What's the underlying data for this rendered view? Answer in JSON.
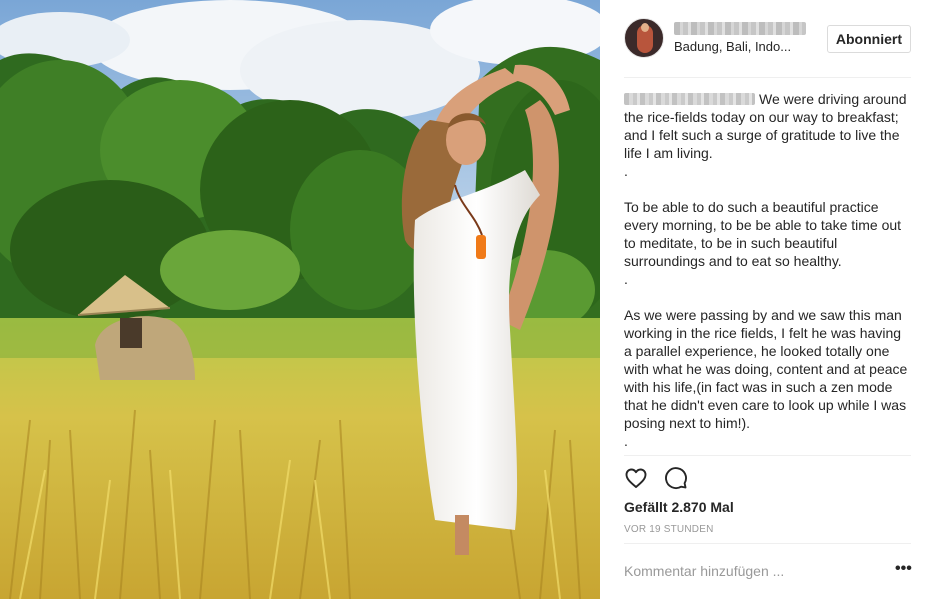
{
  "post": {
    "username": "",
    "location": "Badung, Bali, Indo...",
    "follow_label": "Abonniert",
    "caption_user": "",
    "caption": [
      "We were driving around the rice-fields today on our way to breakfast; and I felt such a surge of gratitude to live the life I am living.",
      ".",
      "To be able to do such a beautiful practice every morning, to be be able to take time out to meditate, to be in such beautiful surroundings and to eat so healthy.",
      ".",
      "As we were passing by and we saw this man working in the rice fields, I felt he was having a parallel experience, he looked totally one with what he was doing, content and at peace with his life,(in fact was in such a zen mode that he didn't even care to look up while I was posing next to him!).",
      "."
    ],
    "likes": "Gefällt 2.870 Mal",
    "time": "VOR 19 STUNDEN",
    "comment_placeholder": "Kommentar hinzufügen ...",
    "more_glyph": "•••"
  },
  "icons": {
    "like": "heart-outline-icon",
    "comment": "speech-bubble-icon",
    "more": "ellipsis-icon"
  },
  "colors": {
    "text": "#262626",
    "muted": "#999999",
    "border": "#dbdbdb",
    "divider": "#efefef"
  }
}
